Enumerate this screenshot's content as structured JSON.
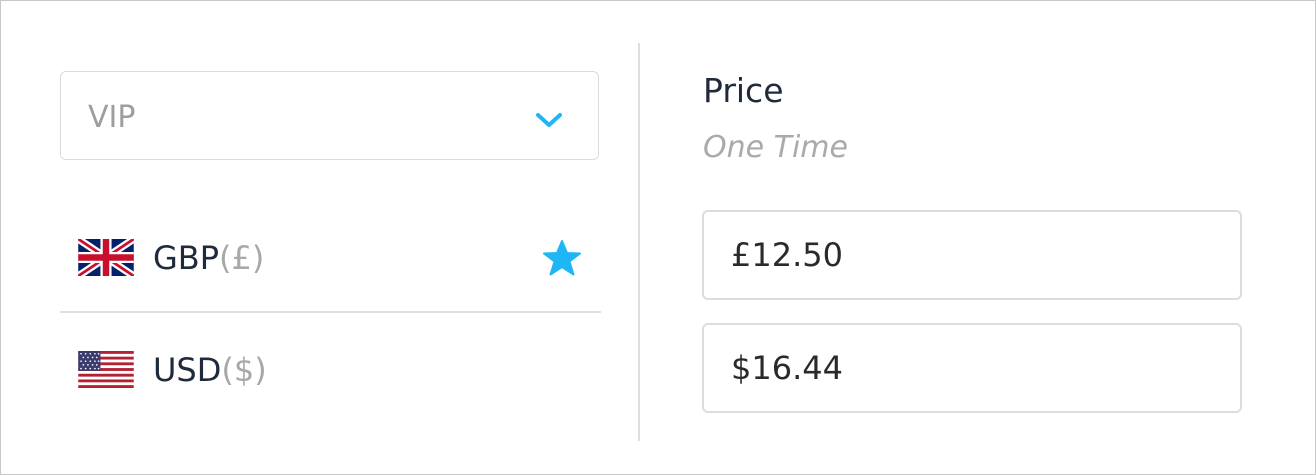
{
  "tier_select": {
    "value": "VIP",
    "icon": "chevron-down-icon",
    "accent_color": "#1fb6f5"
  },
  "currencies": [
    {
      "code": "GBP",
      "symbol": "(£)",
      "flag": "uk-flag-icon",
      "favorite": true
    },
    {
      "code": "USD",
      "symbol": "($)",
      "flag": "us-flag-icon",
      "favorite": false
    }
  ],
  "price": {
    "title": "Price",
    "subtitle": "One Time",
    "values": [
      "£12.50",
      "$16.44"
    ]
  },
  "colors": {
    "accent": "#1fb6f5",
    "text": "#1f2a3a",
    "muted": "#a8a8a8"
  }
}
